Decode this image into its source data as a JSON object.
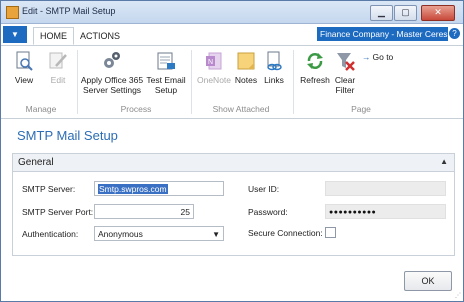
{
  "window": {
    "title": "Edit - SMTP Mail Setup",
    "controls": {
      "minimize": "▁",
      "maximize": "▢",
      "close": "✕"
    }
  },
  "ribbon": {
    "menu_glyph": "▼",
    "tabs": [
      {
        "label": "HOME",
        "active": true
      },
      {
        "label": "ACTIONS",
        "active": false
      }
    ],
    "company": "Finance Company - Master Ceres...",
    "groups": {
      "manage": {
        "label": "Manage",
        "buttons": [
          {
            "label": "View",
            "icon": "view-icon",
            "enabled": true
          },
          {
            "label": "Edit",
            "icon": "edit-icon",
            "enabled": false
          }
        ]
      },
      "process": {
        "label": "Process",
        "buttons": [
          {
            "label": "Apply Office 365 Server Settings",
            "line1": "Apply Office 365",
            "line2": "Server Settings",
            "icon": "gears-icon",
            "enabled": true
          },
          {
            "label": "Test Email Setup",
            "line1": "Test Email",
            "line2": "Setup",
            "icon": "test-email-icon",
            "enabled": true
          }
        ]
      },
      "show_attached": {
        "label": "Show Attached",
        "buttons": [
          {
            "label": "OneNote",
            "icon": "onenote-icon",
            "enabled": false
          },
          {
            "label": "Notes",
            "icon": "notes-icon",
            "enabled": true
          },
          {
            "label": "Links",
            "icon": "links-icon",
            "enabled": true
          }
        ]
      },
      "page": {
        "label": "Page",
        "buttons": [
          {
            "label": "Refresh",
            "icon": "refresh-icon",
            "enabled": true
          },
          {
            "label": "Clear Filter",
            "line1": "Clear",
            "line2": "Filter",
            "icon": "clear-filter-icon",
            "enabled": true
          },
          {
            "label": "Go to",
            "icon": "arrow-right-icon",
            "enabled": true
          }
        ]
      }
    }
  },
  "page_title": "SMTP Mail Setup",
  "general": {
    "header": "General",
    "fields": {
      "smtp_server": {
        "label": "SMTP Server:",
        "value": "Smtp.swpros.com"
      },
      "smtp_server_port": {
        "label": "SMTP Server Port:",
        "value": "25"
      },
      "authentication": {
        "label": "Authentication:",
        "value": "Anonymous"
      },
      "user_id": {
        "label": "User ID:",
        "value": ""
      },
      "password": {
        "label": "Password:",
        "value": "●●●●●●●●●●"
      },
      "secure_connection": {
        "label": "Secure Connection:",
        "checked": false
      }
    }
  },
  "ok_label": "OK"
}
